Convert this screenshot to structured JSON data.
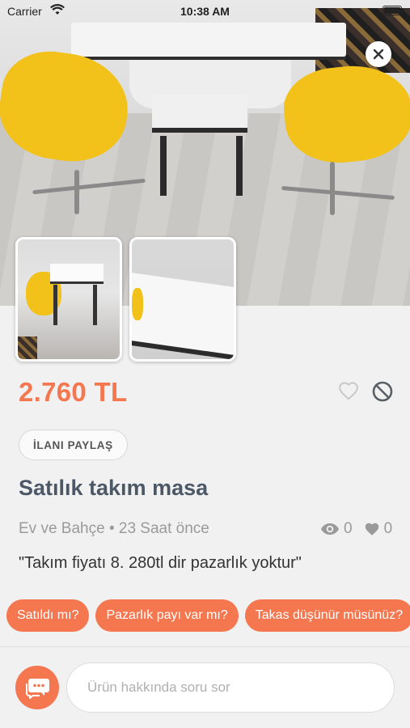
{
  "status_bar": {
    "carrier": "Carrier",
    "time": "10:38 AM"
  },
  "listing": {
    "price": "2.760 TL",
    "share_label": "İLANI PAYLAŞ",
    "title": "Satılık takım masa",
    "meta": "Ev ve Bahçe • 23 Saat önce",
    "views": "0",
    "likes": "0",
    "description": "\"Takım fiyatı 8. 280tl dir pazarlık yoktur\""
  },
  "quick_questions": [
    "Satıldı mı?",
    "Pazarlık payı var mı?",
    "Takas düşünür müsünüz?"
  ],
  "ask": {
    "placeholder": "Ürün hakkında soru sor"
  },
  "icons": {
    "close": "close-icon",
    "heart": "heart-icon",
    "block": "block-icon",
    "eye": "eye-icon",
    "chat": "chat-icon",
    "wifi": "wifi-icon",
    "battery": "battery-icon"
  },
  "colors": {
    "accent": "#f4774f",
    "title": "#4c5866",
    "muted": "#9a9a9a"
  }
}
